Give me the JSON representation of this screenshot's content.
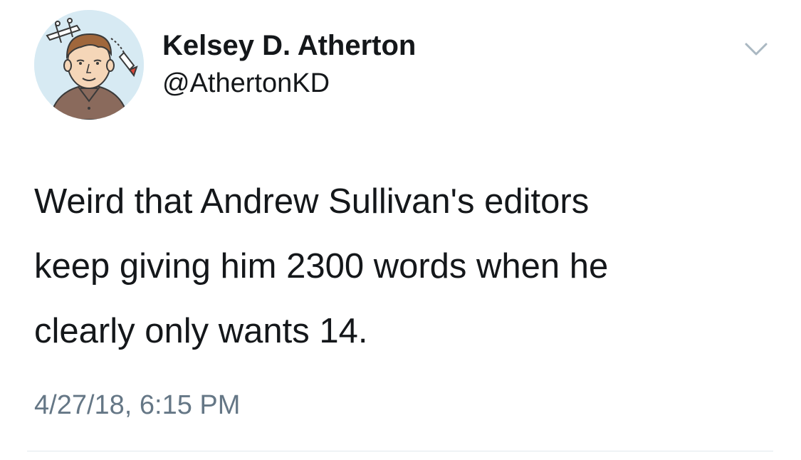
{
  "user": {
    "display_name": "Kelsey D. Atherton",
    "handle": "@AthertonKD",
    "avatar_icon": "illustrated-portrait-avatar"
  },
  "tweet": {
    "text": "Weird that Andrew Sullivan's editors\nkeep giving him 2300 words when he\nclearly only wants 14.",
    "timestamp": "4/27/18, 6:15 PM"
  },
  "menu": {
    "icon": "chevron-down-icon"
  },
  "colors": {
    "text": "#14171a",
    "secondary": "#657786",
    "divider": "#e1e8ed",
    "avatar_bg": "#d7eaf3"
  }
}
